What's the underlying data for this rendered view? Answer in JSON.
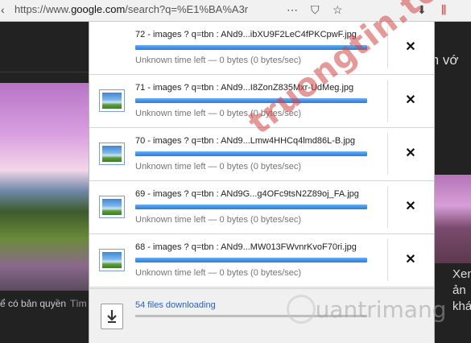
{
  "browser": {
    "url_prefix": "https://www.",
    "url_domain": "google.com",
    "url_rest": "/search?q=%E1%BA%A3r"
  },
  "background": {
    "text_right_top": "m vớ",
    "text_bottom_left": "ể có bản quyền",
    "text_bottom_tim": "Tìm",
    "text_right_1": "Xen",
    "text_right_2": "ản",
    "text_right_3": "khá"
  },
  "downloads": {
    "items": [
      {
        "name": "72 - images ? q=tbn : ANd9...ibXU9F2LeC4fPKCpwF.jpg",
        "status": "Unknown time left — 0 bytes (0 bytes/sec)",
        "progress": 1.0,
        "show_icon": false
      },
      {
        "name": "71 - images ? q=tbn : ANd9...I8ZonZ835Mxr-UdMeg.jpg",
        "status": "Unknown time left — 0 bytes (0 bytes/sec)",
        "progress": 1.0,
        "show_icon": true
      },
      {
        "name": "70 - images ? q=tbn : ANd9...Lmw4HHCq4lmd86L-B.jpg",
        "status": "Unknown time left — 0 bytes (0 bytes/sec)",
        "progress": 1.0,
        "show_icon": true
      },
      {
        "name": "69 - images ? q=tbn : ANd9G...g4OFc9tsN2Z89oj_FA.jpg",
        "status": "Unknown time left — 0 bytes (0 bytes/sec)",
        "progress": 1.0,
        "show_icon": true
      },
      {
        "name": "68 - images ? q=tbn : ANd9...MW013FWvnrKvoF70ri.jpg",
        "status": "Unknown time left — 0 bytes (0 bytes/sec)",
        "progress": 1.0,
        "show_icon": true
      }
    ],
    "close_glyph": "✕",
    "footer_link": "54 files downloading",
    "footer_progress": 1.0
  },
  "watermark": {
    "diagonal": "truongtin.top",
    "bottom": "uantrimang"
  },
  "colors": {
    "progress_blue": "#3d8ee3",
    "link_blue": "#2a62b8"
  }
}
